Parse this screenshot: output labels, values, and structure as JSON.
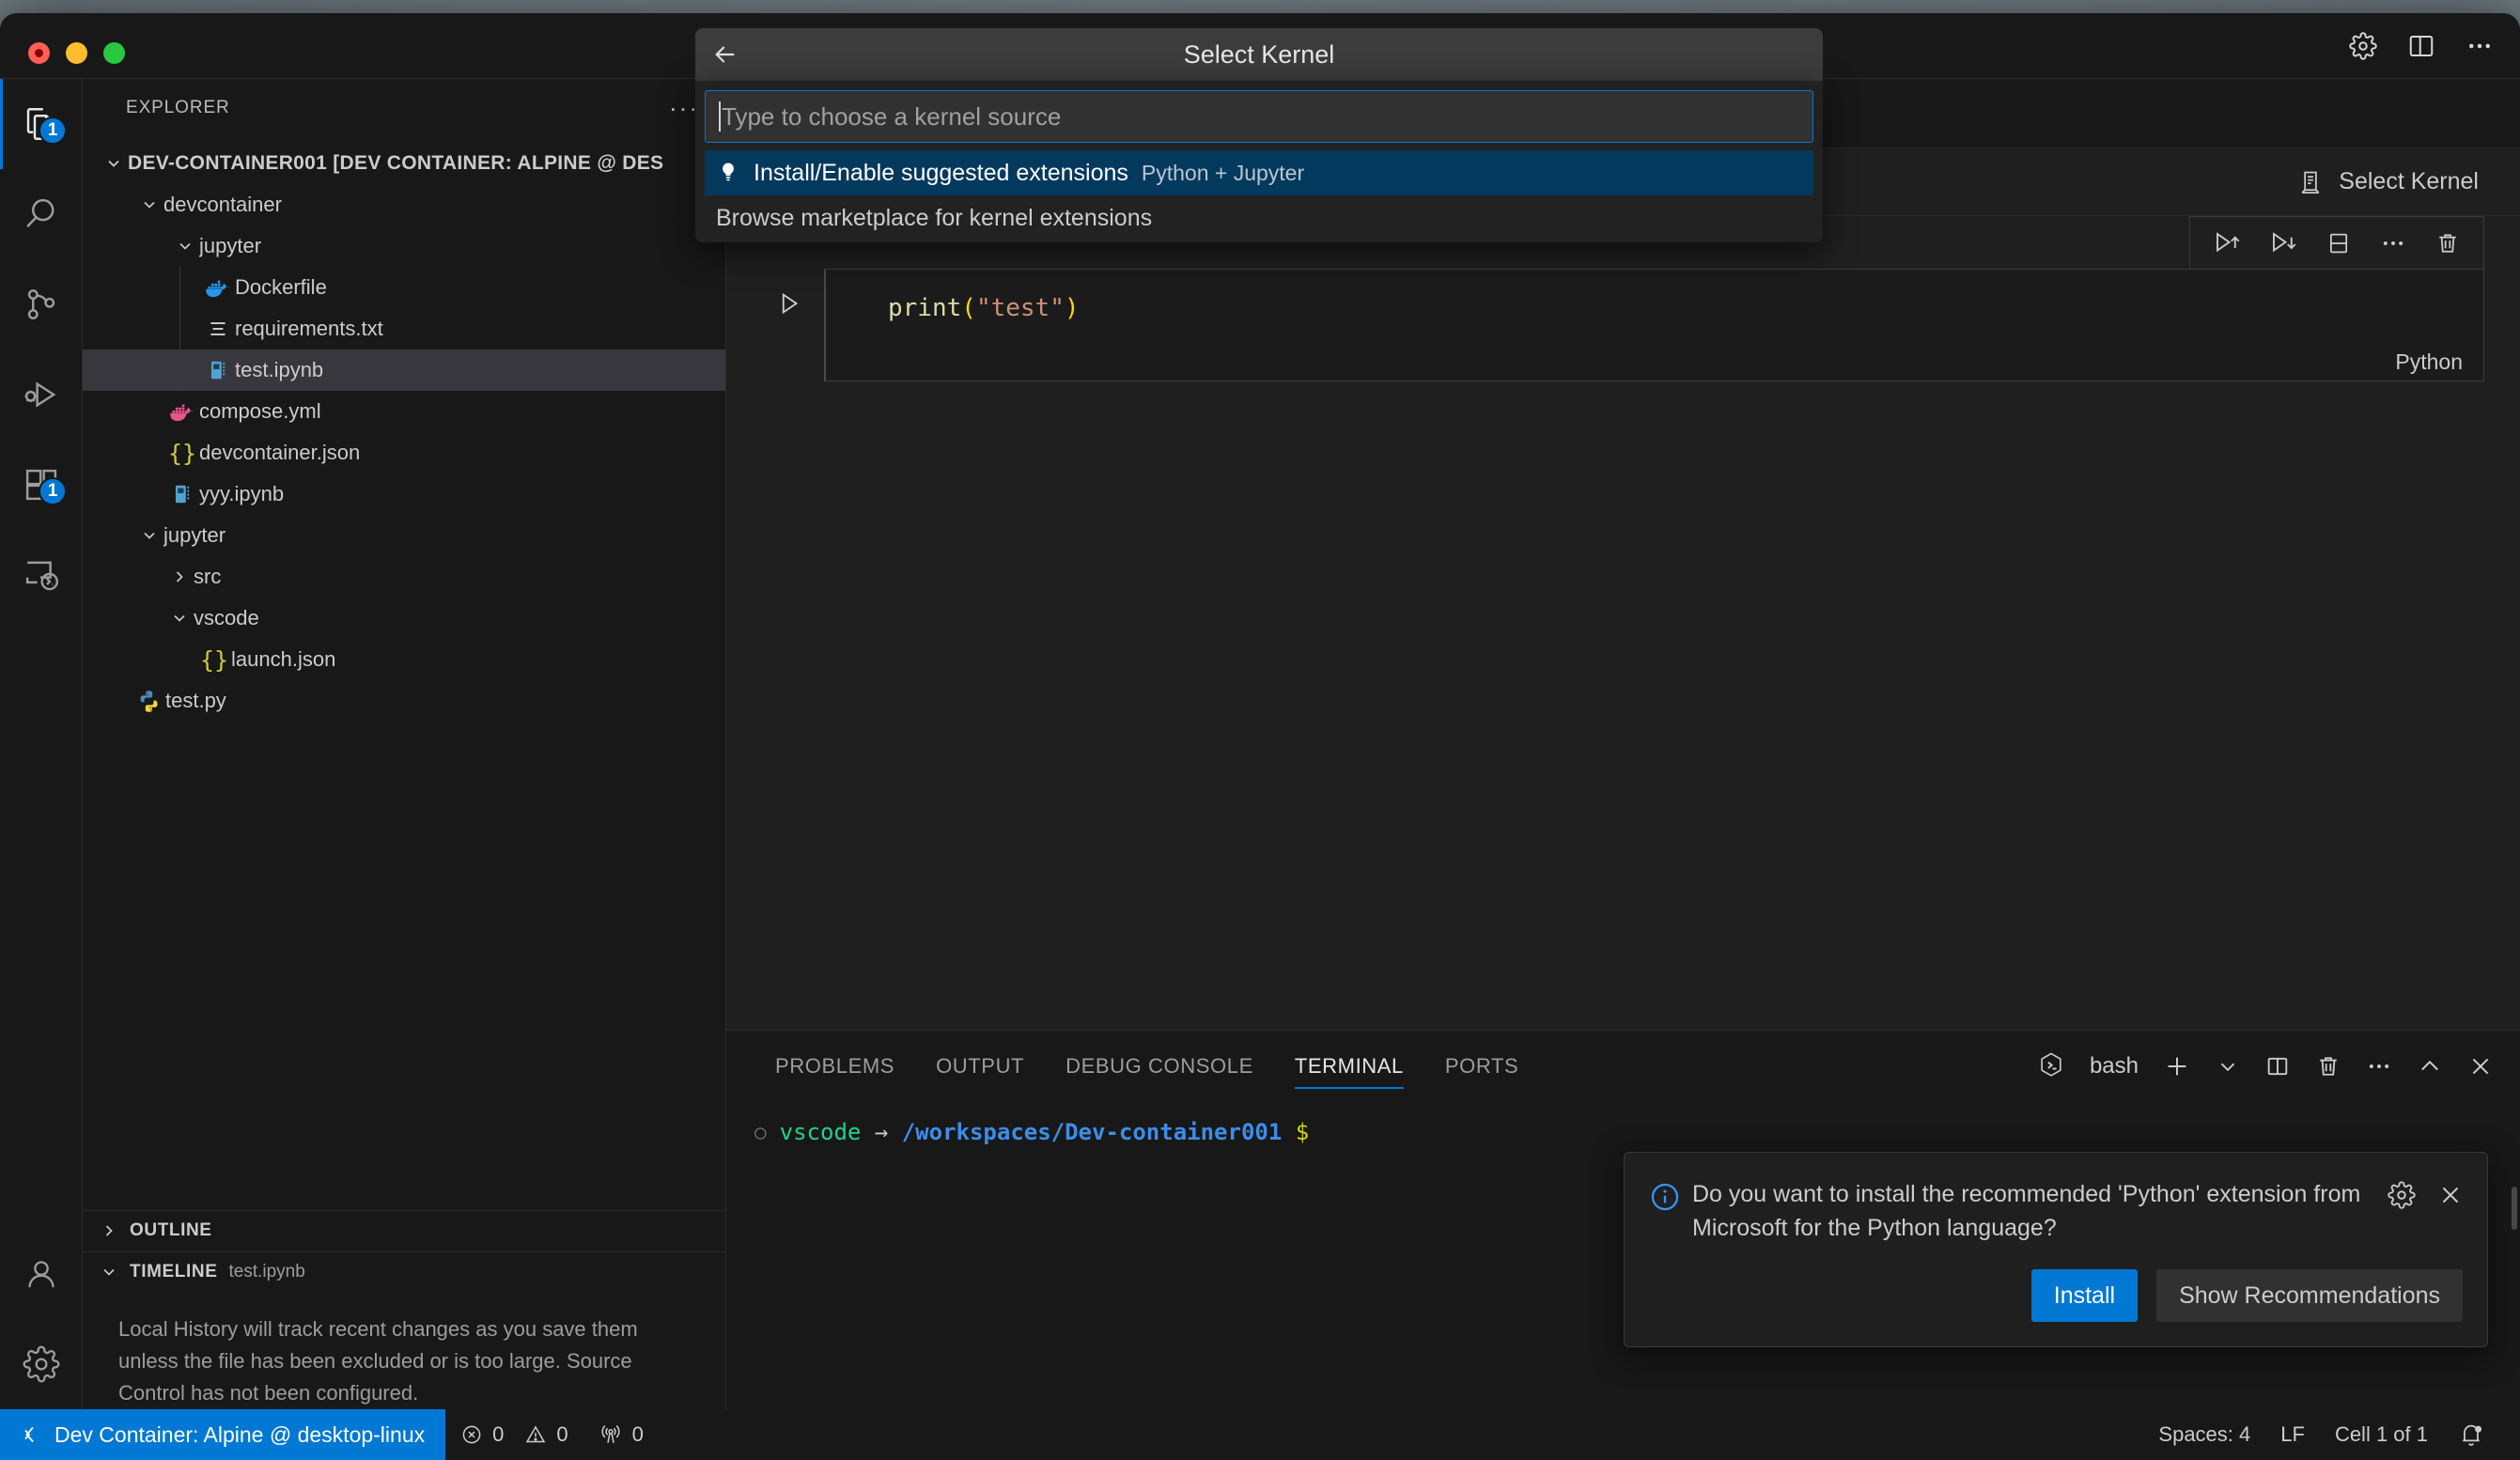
{
  "window": {
    "traffic_lights": [
      "close",
      "minimize",
      "maximize"
    ],
    "titlebar_icons": [
      "gear-icon",
      "layout-panel-icon",
      "more-icon"
    ]
  },
  "activity_bar": {
    "items": [
      {
        "name": "explorer",
        "icon": "files-icon",
        "badge": "1",
        "active": true
      },
      {
        "name": "search",
        "icon": "search-icon",
        "badge": "",
        "active": false
      },
      {
        "name": "source-control",
        "icon": "source-control-icon",
        "badge": "",
        "active": false
      },
      {
        "name": "run-and-debug",
        "icon": "debug-icon",
        "badge": "",
        "active": false
      },
      {
        "name": "extensions",
        "icon": "extensions-icon",
        "badge": "1",
        "active": false
      },
      {
        "name": "remote-explorer",
        "icon": "remote-explorer-icon",
        "badge": "",
        "active": false
      }
    ],
    "bottom_items": [
      {
        "name": "accounts",
        "icon": "account-icon"
      },
      {
        "name": "manage",
        "icon": "gear-icon"
      }
    ]
  },
  "sidebar": {
    "title": "EXPLORER",
    "more_actions": "···",
    "root": {
      "label": "DEV-CONTAINER001 [DEV CONTAINER: ALPINE @ DES",
      "expanded": true
    },
    "tree": [
      {
        "label": "devcontainer",
        "type": "folder",
        "depth": 1,
        "expanded": true,
        "icon": "chevron-down-icon"
      },
      {
        "label": "jupyter",
        "type": "folder",
        "depth": 2,
        "expanded": true,
        "icon": "chevron-down-icon"
      },
      {
        "label": "Dockerfile",
        "type": "file",
        "depth": 3,
        "icon": "docker-icon"
      },
      {
        "label": "requirements.txt",
        "type": "file",
        "depth": 3,
        "icon": "text-lines-icon"
      },
      {
        "label": "test.ipynb",
        "type": "file",
        "depth": 3,
        "icon": "notebook-icon",
        "selected": true
      },
      {
        "label": "compose.yml",
        "type": "file",
        "depth": 2,
        "icon": "docker-icon"
      },
      {
        "label": "devcontainer.json",
        "type": "file",
        "depth": 2,
        "icon": "json-icon"
      },
      {
        "label": "yyy.ipynb",
        "type": "file",
        "depth": 2,
        "icon": "notebook-icon"
      },
      {
        "label": "jupyter",
        "type": "folder",
        "depth": 1,
        "expanded": true,
        "icon": "chevron-down-icon"
      },
      {
        "label": "src",
        "type": "folder",
        "depth": 2,
        "expanded": false,
        "icon": "chevron-right-icon"
      },
      {
        "label": "vscode",
        "type": "folder",
        "depth": 2,
        "expanded": true,
        "icon": "chevron-down-icon"
      },
      {
        "label": "launch.json",
        "type": "file",
        "depth": 3,
        "icon": "json-icon"
      },
      {
        "label": "test.py",
        "type": "file",
        "depth": 1,
        "icon": "python-icon"
      }
    ],
    "outline": {
      "label": "OUTLINE",
      "expanded": false
    },
    "timeline": {
      "label": "TIMELINE",
      "subtitle": "test.ipynb",
      "expanded": true,
      "message": "Local History will track recent changes as you save them unless the file has been excluded or is too large. Source Control has not been configured."
    }
  },
  "quick_pick": {
    "title": "Select Kernel",
    "back_icon": "arrow-left-icon",
    "input_placeholder": "Type to choose a kernel source",
    "input_value": "",
    "items": [
      {
        "label": "Install/Enable suggested extensions",
        "description": "Python + Jupyter",
        "icon": "lightbulb-icon",
        "selected": true
      },
      {
        "label": "Browse marketplace for kernel extensions",
        "description": "",
        "icon": "",
        "selected": false
      }
    ]
  },
  "notebook": {
    "select_kernel_label": "Select Kernel",
    "select_kernel_icon": "server-icon",
    "cell_toolbar_icons": [
      "run-above-icon",
      "run-below-icon",
      "split-cell-icon",
      "more-icon",
      "delete-cell-icon"
    ],
    "run_icon": "play-icon",
    "cell": {
      "code_prefix": "print",
      "code_open": "(",
      "code_string": "\"test\"",
      "code_close": ")",
      "language": "Python"
    }
  },
  "panel": {
    "tabs": [
      {
        "label": "PROBLEMS",
        "active": false
      },
      {
        "label": "OUTPUT",
        "active": false
      },
      {
        "label": "DEBUG CONSOLE",
        "active": false
      },
      {
        "label": "TERMINAL",
        "active": true
      },
      {
        "label": "PORTS",
        "active": false
      }
    ],
    "shell_label": "bash",
    "shell_icon": "bash-icon",
    "actions": [
      "new-terminal-icon",
      "chevron-down-icon",
      "split-terminal-icon",
      "kill-terminal-icon",
      "more-icon",
      "maximize-panel-icon",
      "close-panel-icon"
    ],
    "terminal": {
      "status_icon": "○",
      "user": "vscode",
      "arrow": "→",
      "path": "/workspaces/Dev-container001",
      "prompt": "$"
    }
  },
  "notification": {
    "icon": "info-icon",
    "message": "Do you want to install the recommended 'Python' extension from Microsoft for the Python language?",
    "gear_icon": "gear-icon",
    "close_icon": "close-icon",
    "primary_button": "Install",
    "secondary_button": "Show Recommendations"
  },
  "status_bar": {
    "remote_icon": "remote-indicator-icon",
    "remote_label": "Dev Container: Alpine @ desktop-linux",
    "errors_icon": "error-icon",
    "errors": "0",
    "warnings_icon": "warning-icon",
    "warnings": "0",
    "ports_icon": "radio-tower-icon",
    "ports": "0",
    "spaces": "Spaces: 4",
    "eol": "LF",
    "cell_position": "Cell 1 of 1",
    "bell_icon": "bell-dot-icon"
  },
  "colors": {
    "accent": "#0078d4",
    "selected_row": "#37373d",
    "quickpick_selected": "#04395e",
    "terminal_user": "#23d18b",
    "terminal_path": "#3b8eea"
  }
}
